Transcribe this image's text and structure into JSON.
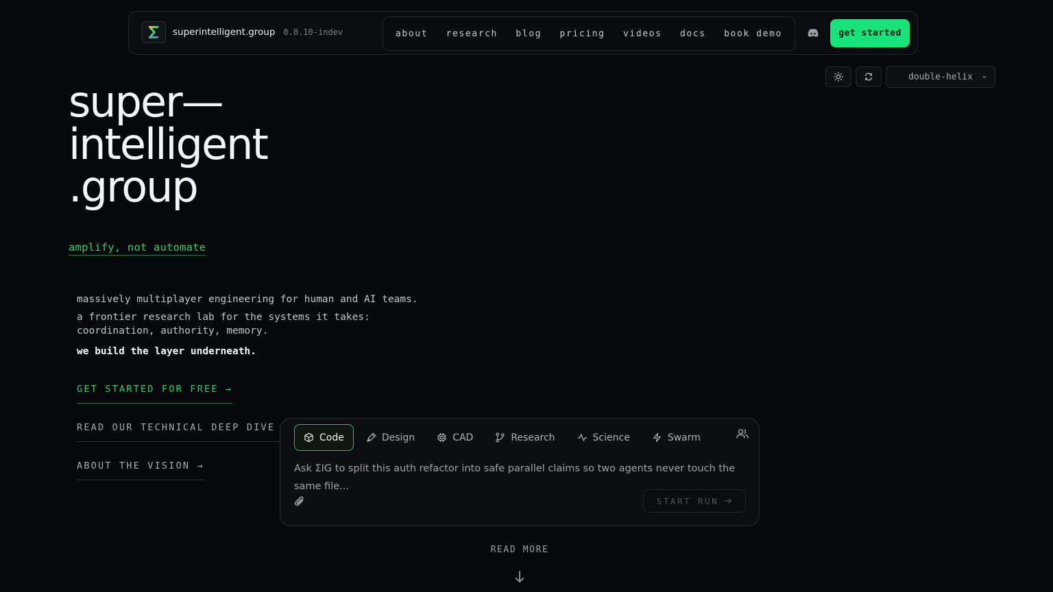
{
  "nav": {
    "brand_name": "superintelligent.group",
    "version": "0.0.10-indev",
    "links": [
      "about",
      "research",
      "blog",
      "pricing",
      "videos",
      "docs",
      "book demo"
    ],
    "cta_label": "get started",
    "discord_icon": "discord-icon",
    "logo_icon": "sigma-logo-icon"
  },
  "toolbar": {
    "theme_toggle_icon": "sun-icon",
    "refresh_icon": "refresh-icon",
    "theme_value": "double-helix"
  },
  "hero": {
    "title_lines": [
      "super—",
      "intelligent",
      ".group"
    ],
    "tagline": "amplify, not automate",
    "desc1": "massively multiplayer engineering for human and AI teams.",
    "desc2": "a frontier research lab for the systems it takes: coordination, authority, memory.",
    "desc3": "we build the layer underneath.",
    "links": [
      "GET STARTED FOR FREE →",
      "READ OUR TECHNICAL DEEP DIVE →",
      "ABOUT THE VISION →"
    ]
  },
  "composer": {
    "tabs": [
      {
        "label": "Code",
        "icon": "cube-icon"
      },
      {
        "label": "Design",
        "icon": "pen-icon"
      },
      {
        "label": "CAD",
        "icon": "chip-icon"
      },
      {
        "label": "Research",
        "icon": "branch-icon"
      },
      {
        "label": "Science",
        "icon": "pulse-icon"
      },
      {
        "label": "Swarm",
        "icon": "bolt-icon"
      }
    ],
    "active_tab": "Code",
    "placeholder": "Ask ΣIG to split this auth refactor into safe parallel claims so two agents never touch the same file...",
    "start_label": "START RUN",
    "people_icon": "users-icon",
    "attach_icon": "paperclip-icon"
  },
  "footer": {
    "read_more": "READ MORE"
  },
  "colors": {
    "background": "#07080b",
    "accent": "#18e37a",
    "accent_text": "#27d36d"
  }
}
